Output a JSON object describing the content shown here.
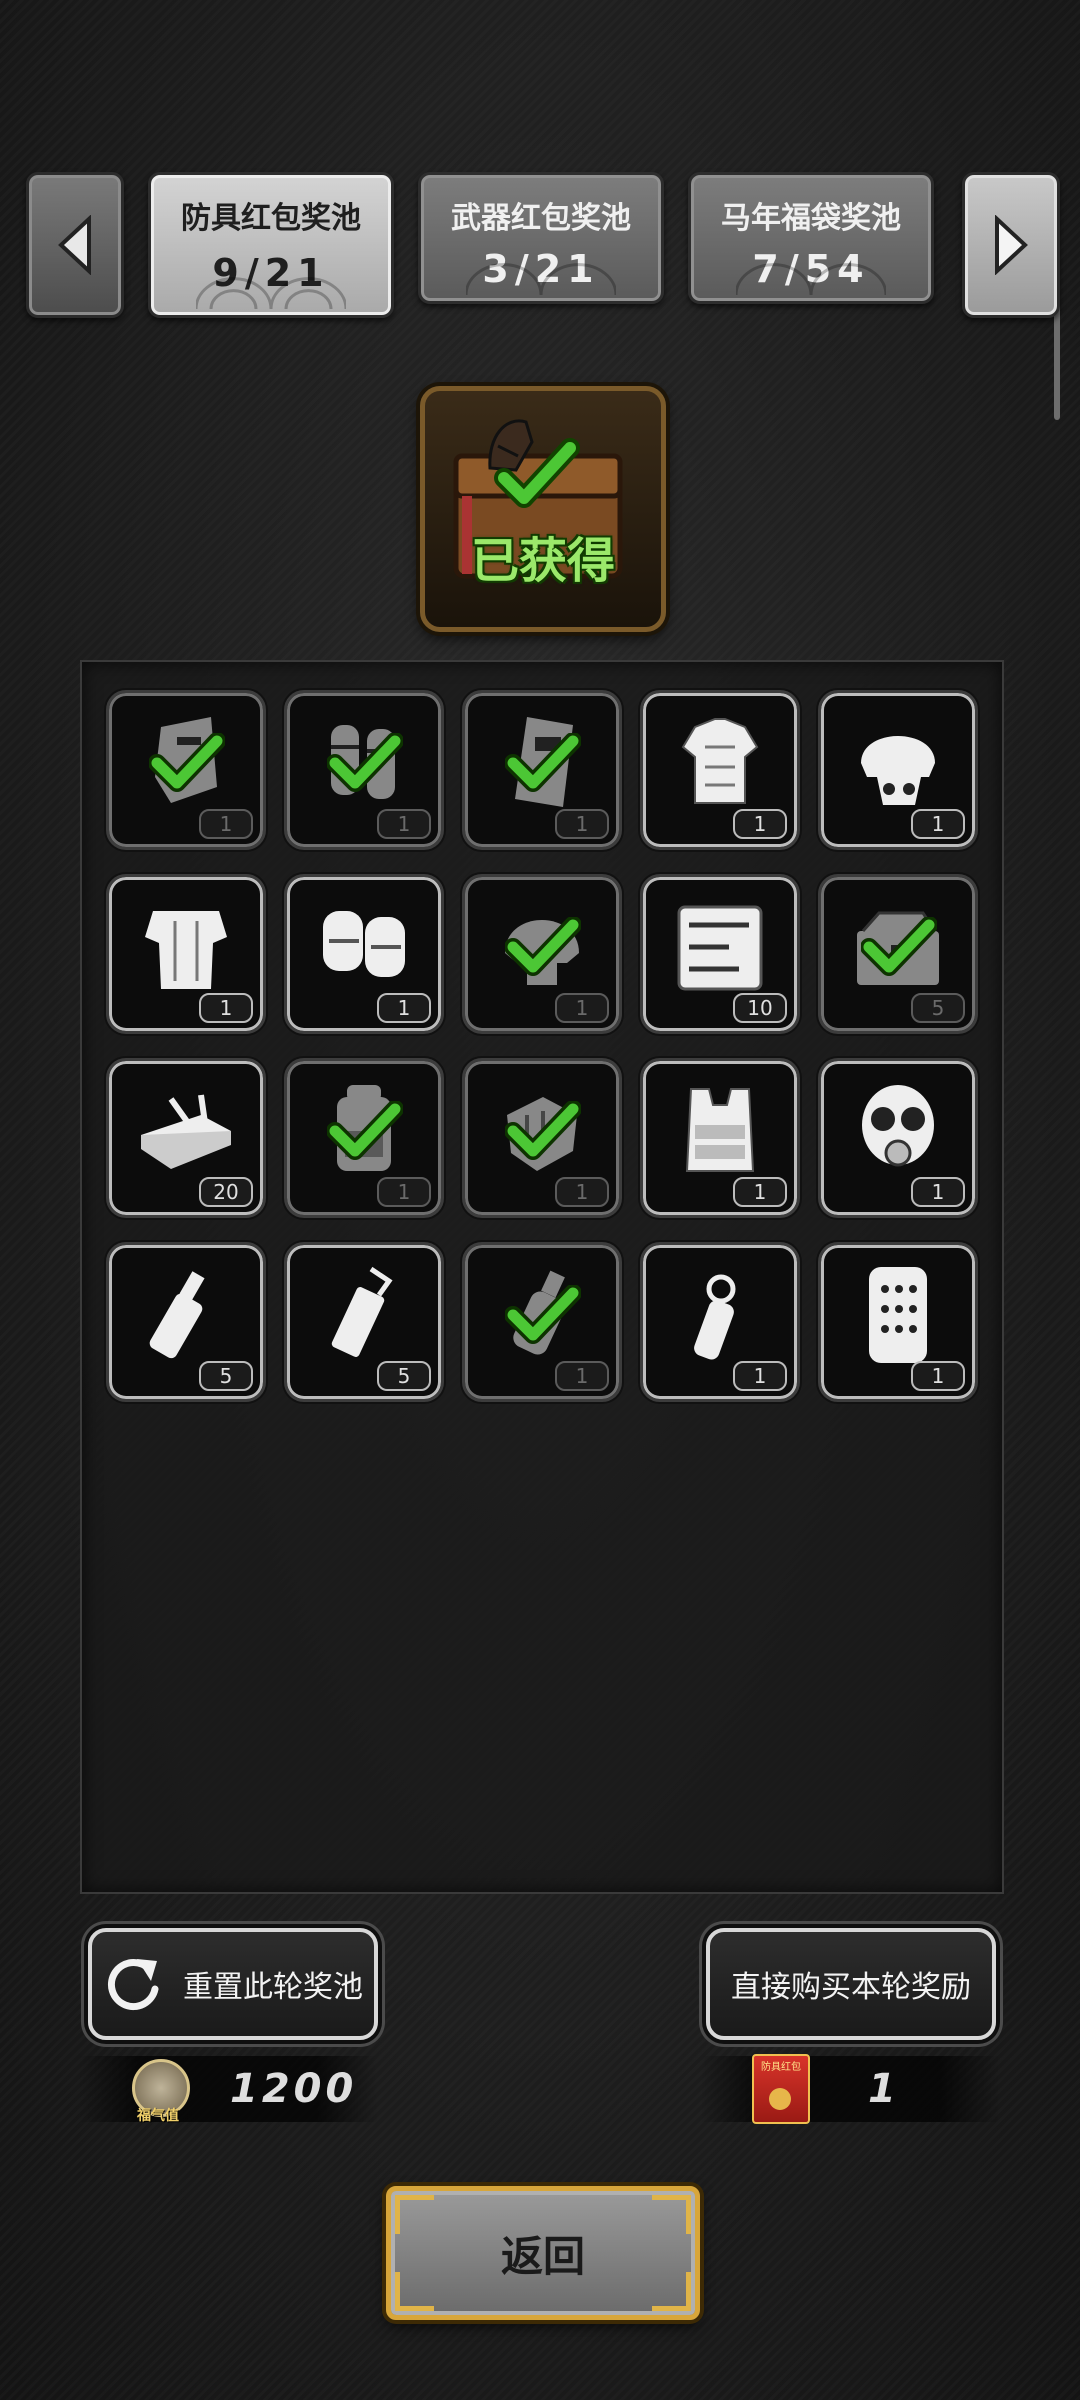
{
  "tabs": [
    {
      "name": "防具红包奖池",
      "count": "9/21",
      "active": true
    },
    {
      "name": "武器红包奖池",
      "count": "3/21",
      "active": false
    },
    {
      "name": "马年福袋奖池",
      "count": "7/54",
      "active": false
    }
  ],
  "arrows": {
    "prev": "left-arrow-icon",
    "next": "right-arrow-icon"
  },
  "chest": {
    "status": "已获得",
    "icon": "horse-chest-icon"
  },
  "items": [
    {
      "icon": "riot-shield-icon",
      "qty": "1",
      "owned": true
    },
    {
      "icon": "arm-guards-icon",
      "qty": "1",
      "owned": true
    },
    {
      "icon": "tactical-shield-icon",
      "qty": "1",
      "owned": true
    },
    {
      "icon": "body-armor-icon",
      "qty": "1",
      "owned": false
    },
    {
      "icon": "skull-helmet-icon",
      "qty": "1",
      "owned": false
    },
    {
      "icon": "heavy-armor-icon",
      "qty": "1",
      "owned": false
    },
    {
      "icon": "knee-pads-icon",
      "qty": "1",
      "owned": false
    },
    {
      "icon": "helmet-icon",
      "qty": "1",
      "owned": true
    },
    {
      "icon": "tool-kit-icon",
      "qty": "10",
      "owned": false
    },
    {
      "icon": "toolbox-icon",
      "qty": "5",
      "owned": true
    },
    {
      "icon": "repair-kit-icon",
      "qty": "20",
      "owned": false
    },
    {
      "icon": "backpack-icon",
      "qty": "1",
      "owned": true
    },
    {
      "icon": "gloves-icon",
      "qty": "1",
      "owned": true
    },
    {
      "icon": "vest-icon",
      "qty": "1",
      "owned": false
    },
    {
      "icon": "gas-mask-icon",
      "qty": "1",
      "owned": false
    },
    {
      "icon": "flash-grenade-icon",
      "qty": "5",
      "owned": false
    },
    {
      "icon": "smoke-grenade-icon",
      "qty": "5",
      "owned": false
    },
    {
      "icon": "frag-grenade-icon",
      "qty": "1",
      "owned": true
    },
    {
      "icon": "stun-grenade-icon",
      "qty": "1",
      "owned": false
    },
    {
      "icon": "ballistic-plate-icon",
      "qty": "1",
      "owned": false
    }
  ],
  "reset_button": {
    "label": "重置此轮奖池",
    "icon": "refresh-icon"
  },
  "buy_button": {
    "label": "直接购买本轮奖励"
  },
  "fortune": {
    "value": "1200",
    "icon_label": "福气值"
  },
  "redpacket": {
    "value": "1",
    "icon_label": "防具红包"
  },
  "back_button": {
    "label": "返回"
  },
  "colors": {
    "check_green": "#4cc735",
    "gold_frame": "#d8a63a",
    "owned_label": "#9be86a"
  }
}
